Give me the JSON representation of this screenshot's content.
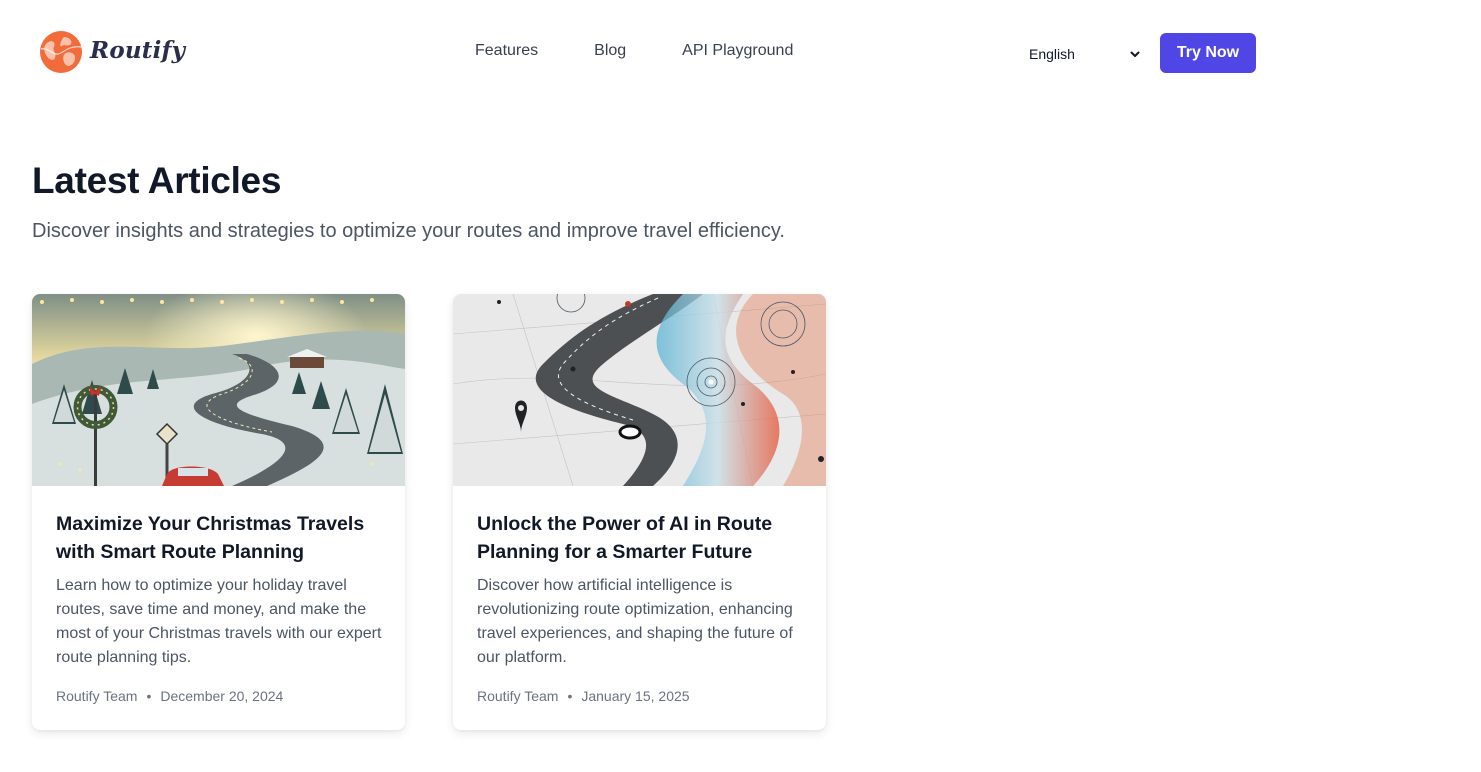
{
  "brand": {
    "name": "Routify",
    "logo_icon": "globe-icon",
    "accent_color": "#4f46e5",
    "logo_color": "#f26b3a"
  },
  "nav": {
    "items": [
      {
        "label": "Features"
      },
      {
        "label": "Blog"
      },
      {
        "label": "API Playground"
      }
    ]
  },
  "language": {
    "selected": "English",
    "icon": "chevron-down-icon"
  },
  "cta": {
    "label": "Try Now"
  },
  "section": {
    "title": "Latest Articles",
    "subtitle": "Discover insights and strategies to optimize your routes and improve travel efficiency."
  },
  "articles": [
    {
      "title": "Maximize Your Christmas Travels with Smart Route Planning",
      "description": "Learn how to optimize your holiday travel routes, save time and money, and make the most of your Christmas travels with our expert route planning tips.",
      "author": "Routify Team",
      "date": "December 20, 2024",
      "image": "winter-road-illustration"
    },
    {
      "title": "Unlock the Power of AI in Route Planning for a Smarter Future",
      "description": "Discover how artificial intelligence is revolutionizing route optimization, enhancing travel experiences, and shaping the future of our platform.",
      "author": "Routify Team",
      "date": "January 15, 2025",
      "image": "ai-route-illustration"
    }
  ]
}
